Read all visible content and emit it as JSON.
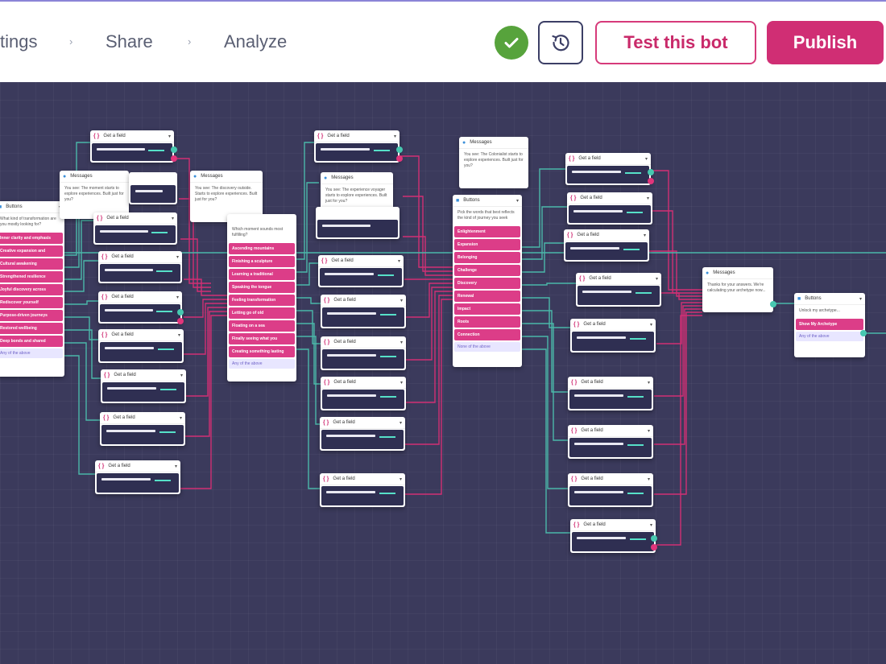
{
  "nav": {
    "item1": "tings",
    "item2": "Share",
    "item3": "Analyze",
    "chevron": "›"
  },
  "header": {
    "status_icon": "check-circle-icon",
    "history_icon": "history-icon",
    "test_label": "Test this bot",
    "publish_label": "Publish"
  },
  "colors": {
    "brand": "#d02e74",
    "canvas": "#3b3a5c",
    "success": "#57a33c",
    "wire_teal": "#4bb8a9",
    "wire_pink": "#d12f74"
  },
  "canvas": {
    "node_labels": {
      "field": "Get a field",
      "messages": "Messages",
      "buttons": "Buttons"
    },
    "nodes": {
      "m1": "You see: The moment starts to explore experiences. Built just for you?",
      "m2": "You see: The discovery outside. Starts to explore experiences. Built just for you?",
      "m3": "You see: The experience voyager starts to explore experiences. Built just for you?",
      "m4": "You see: The Colonialist starts to explore experiences. Built just for you?",
      "m5": "Thanks for your answers. We're calculating your archetype now...",
      "b1": {
        "text": "What kind of transformation are you mostly looking for?",
        "options": [
          "Inner clarity and emphasis",
          "Creative expansion and",
          "Cultural awakening",
          "Strengthened resilience",
          "Joyful discovery across",
          "Rediscover yourself",
          "Purpose-driven journeys",
          "Restored wellbeing",
          "Deep bonds and shared"
        ],
        "foot": "Any of the above"
      },
      "b2": {
        "text": "Which moment sounds most fulfilling?",
        "options": [
          "Ascending mountains",
          "Finishing a sculpture",
          "Learning a traditional",
          "Speaking the tongue",
          "Feeling transformation",
          "Letting go of old",
          "Floating on a sea",
          "Finally seeing what you",
          "Creating something lasting"
        ],
        "foot": "Any of the above"
      },
      "b3": {
        "text": "Pick the words that best reflects the kind of journey you seek",
        "options": [
          "Enlightenment",
          "Expansion",
          "Belonging",
          "Challenge",
          "Discovery",
          "Renewal",
          "Impact",
          "Roots",
          "Connection"
        ],
        "foot": "None of the above"
      },
      "b4": {
        "text": "Unlock my archetype...",
        "options": [
          "Show My Archetype"
        ],
        "foot": "Any of the above"
      }
    }
  }
}
